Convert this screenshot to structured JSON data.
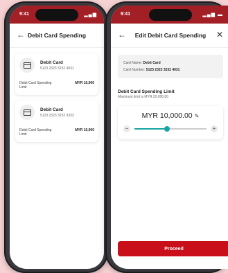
{
  "status": {
    "time": "9:41"
  },
  "screen1": {
    "title": "Debit Card Spending",
    "cards": [
      {
        "name": "Debit Card",
        "number": "5123 2323 3232 4031",
        "limit_label": "Debit Card Spending Limit",
        "limit_value": "MYR 10,000"
      },
      {
        "name": "Debit Card",
        "number": "5123 2323 3232 3333",
        "limit_label": "Debit Card Spending Limit",
        "limit_value": "MYR 10,000"
      }
    ]
  },
  "screen2": {
    "title": "Edit Debit Card Spending",
    "card_name_label": "Card Name:",
    "card_name": "Debit Card",
    "card_number_label": "Card Number:",
    "card_number": "5123 2323 3232 4031",
    "section_title": "Debit Card Spending Limit",
    "section_sub": "Maximum limit is MYR 20,000.00",
    "amount": "MYR 10,000.00",
    "slider_fraction": 0.45,
    "minus": "−",
    "plus": "+",
    "proceed_label": "Proceed"
  },
  "colors": {
    "brand": "#a31f26",
    "button": "#c80f1a",
    "accent": "#1aa3a3"
  }
}
